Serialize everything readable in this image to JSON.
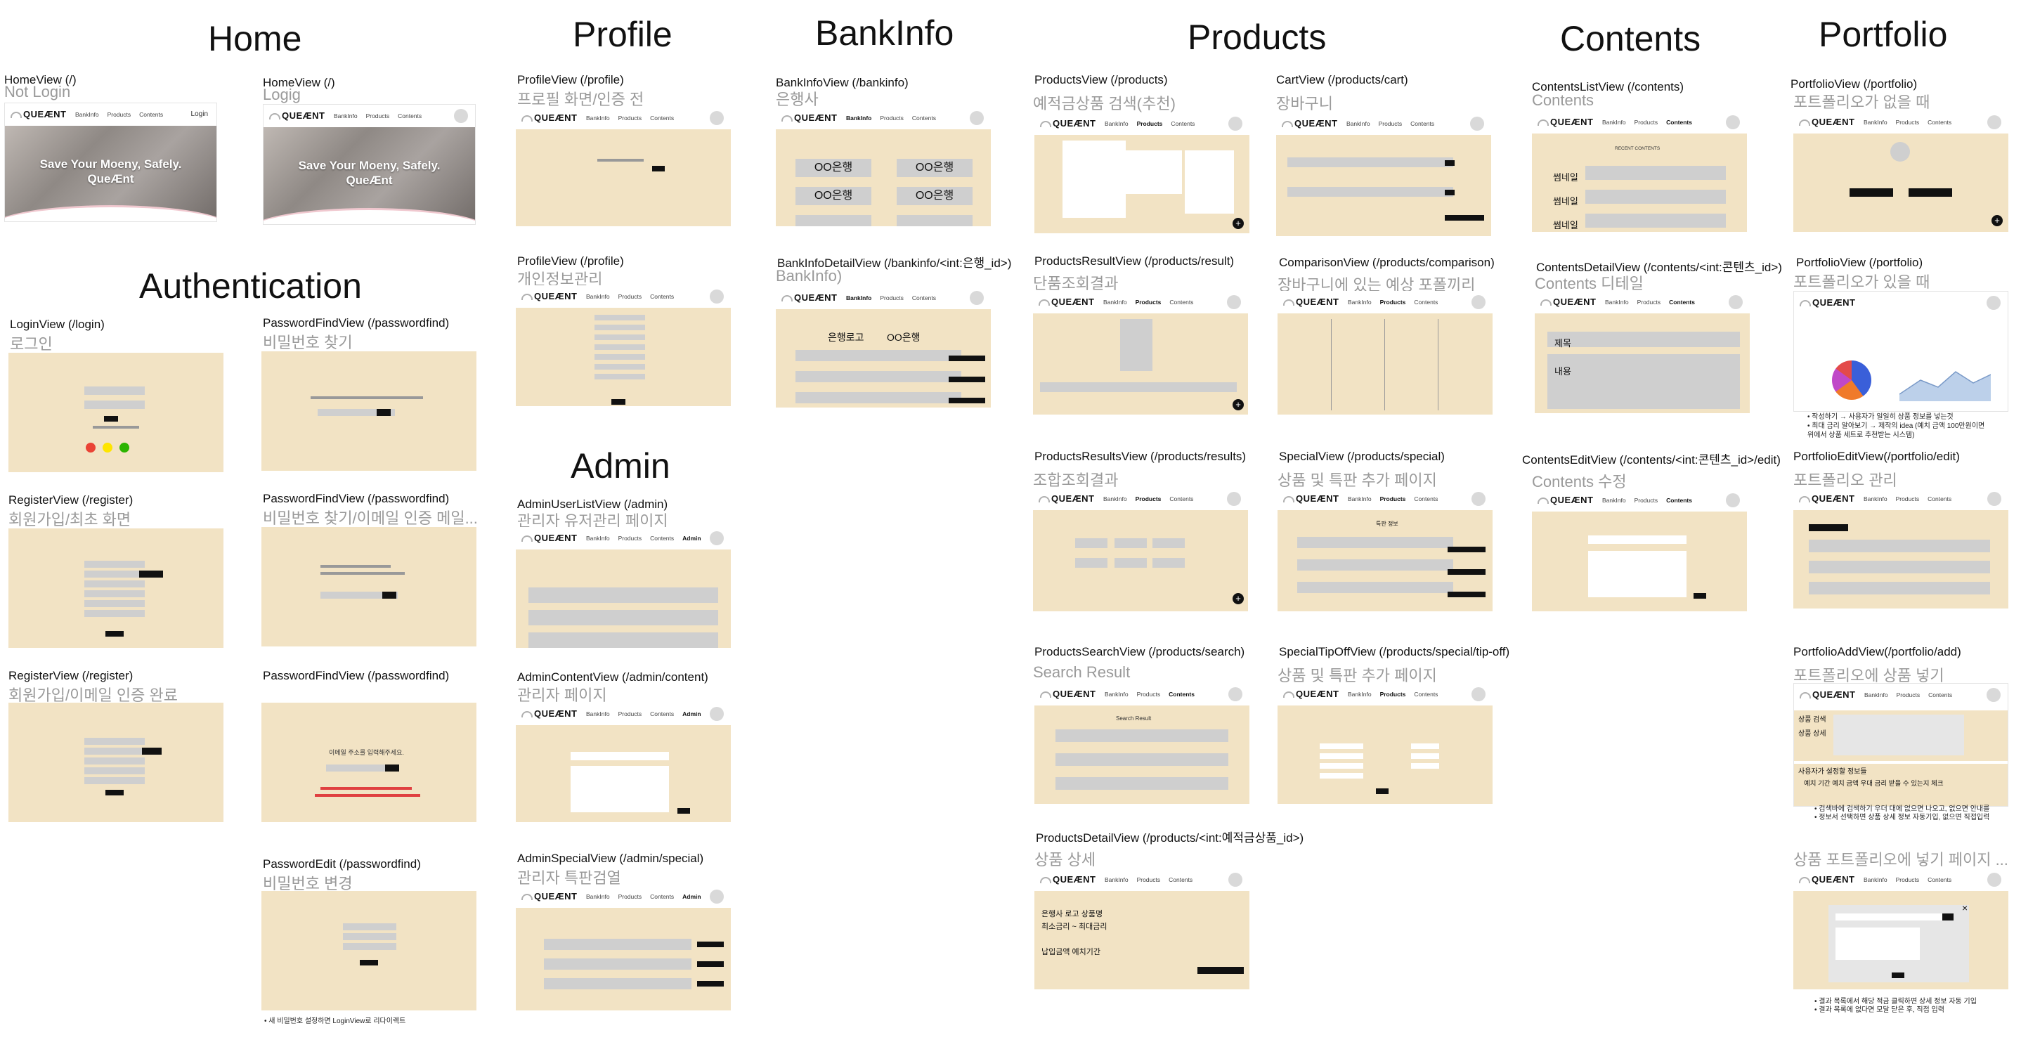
{
  "sections": {
    "home": "Home",
    "profile": "Profile",
    "bankinfo": "BankInfo",
    "products": "Products",
    "contents": "Contents",
    "portfolio": "Portfolio",
    "authentication": "Authentication",
    "admin": "Admin"
  },
  "app": {
    "logo": "QUEÆNT",
    "nav": [
      "BankInfo",
      "Products",
      "Contents"
    ],
    "nav_admin": "Admin",
    "login": "Login",
    "hero_line1": "Save Your Moeny, Safely.",
    "hero_line2": "QueÆnt"
  },
  "screens": {
    "home_nl": {
      "label": "HomeView (/)",
      "sub": "Not Login"
    },
    "home_l": {
      "label": "HomeView (/)",
      "sub": "Logig"
    },
    "login": {
      "label": "LoginView (/login)",
      "sub": "로그인"
    },
    "pwfind1": {
      "label": "PasswordFindView (/passwordfind)",
      "sub": "비밀번호 찾기"
    },
    "register1": {
      "label": "RegisterView (/register)",
      "sub": "회원가입/최초 화면"
    },
    "pwfind2": {
      "label": "PasswordFindView (/passwordfind)",
      "sub": "비밀번호 찾기/이메일 인증 메일..."
    },
    "register2": {
      "label": "RegisterView (/register)",
      "sub": "회원가입/이메일 인증 완료"
    },
    "pwfind3": {
      "label": "PasswordFindView (/passwordfind)",
      "sub": ""
    },
    "pwedit": {
      "label": "PasswordEdit (/passwordfind)",
      "sub": "비밀번호 변경"
    },
    "profile1": {
      "label": "ProfileView (/profile)",
      "sub": "프로필 화면/인증 전"
    },
    "profile2": {
      "label": "ProfileView (/profile)",
      "sub": "개인정보관리"
    },
    "admin_user": {
      "label": "AdminUserListView (/admin)",
      "sub": "관리자 유저관리 페이지"
    },
    "admin_content": {
      "label": "AdminContentView (/admin/content)",
      "sub": "관리자 페이지"
    },
    "admin_special": {
      "label": "AdminSpecialView (/admin/special)",
      "sub": "관리자 특판검열"
    },
    "bankinfo": {
      "label": "BankInfoView (/bankinfo)",
      "sub": "은행사"
    },
    "bankinfo_detail": {
      "label": "BankInfoDetailView (/bankinfo/<int:은행_id>)",
      "sub": "BankInfo)"
    },
    "products": {
      "label": "ProductsView (/products)",
      "sub": "예적금상품 검색(추천)"
    },
    "cart": {
      "label": "CartView (/products/cart)",
      "sub": "장바구니"
    },
    "products_result": {
      "label": "ProductsResultView (/products/result)",
      "sub": "단품조회결과"
    },
    "comparison": {
      "label": "ComparisonView (/products/comparison)",
      "sub": "장바구니에 있는 예상 포폴끼리"
    },
    "products_results": {
      "label": "ProductsResultsView (/products/results)",
      "sub": "조합조회결과"
    },
    "special": {
      "label": "SpecialView (/products/special)",
      "sub": "상품 및 특판 추가 페이지"
    },
    "products_search": {
      "label": "ProductsSearchView (/products/search)",
      "sub": "Search Result"
    },
    "special_tipoff": {
      "label": "SpecialTipOffView (/products/special/tip-off)",
      "sub": "상품 및 특판 추가 페이지"
    },
    "products_detail": {
      "label": "ProductsDetailView (/products/<int:예적금상품_id>)",
      "sub": "상품 상세"
    },
    "contents_list": {
      "label": "ContentsListView (/contents)",
      "sub": "Contents"
    },
    "contents_detail": {
      "label": "ContentsDetailView (/contents/<int:콘텐츠_id>)",
      "sub": "Contents 디테일"
    },
    "contents_edit": {
      "label": "ContentsEditView (/contents/<int:콘텐츠_id>/edit)",
      "sub": "Contents 수정"
    },
    "portfolio_empty": {
      "label": "PortfolioView (/portfolio)",
      "sub": "포트폴리오가 없을 때"
    },
    "portfolio_has": {
      "label": "PortfolioView (/portfolio)",
      "sub": "포트폴리오가 있을 때"
    },
    "portfolio_edit": {
      "label": "PortfolioEditView(/portfolio/edit)",
      "sub": "포트폴리오 관리"
    },
    "portfolio_add": {
      "label": "PortfolioAddView(/portfolio/add)",
      "sub": "포트폴리오에 상품 넣기"
    },
    "portfolio_add2": {
      "label": "",
      "sub": "상품 포트폴리오에 넣기 페이지 ..."
    }
  },
  "frame_text": {
    "bank_name": "OO은행",
    "bank_logo": "은행로고",
    "thumbnail": "썸네일",
    "title": "제목",
    "content": "내용",
    "recent_contents": "RECENT CONTENTS",
    "search_result": "Search Result",
    "special_info": "특판 정보",
    "detail_bank_logo": "은행사 로고   상품명",
    "detail_rate": "최소금리 ~ 최대금리",
    "detail_pay": "납입금액    예치기간",
    "pf_search": "상품 검색",
    "pf_detail": "상품 상세",
    "pf_settings": "사용자가 설정할 정보들",
    "pf_cols": "예치 기간        예치 금액        우대 금리 받을 수 있는지 체크",
    "email_sent": "이메일 주소를 입력해주세요."
  },
  "notes": {
    "pwedit": "• 새 비밀번호 설정하면 LoginView로 리다이렉트",
    "portfolio_has_1": "• 작성하기 → 사용자가 일일히 상품 정보를 넣는것",
    "portfolio_has_2": "• 최대 금리 알아보기 → 제작의 idea (예치 금액 100만원이면",
    "portfolio_has_3": "  위에서 상품 세트로 추천받는 시스템)",
    "portfolio_add_1": "• 검색바에 검색하기 우더 대에 없으면 나오고, 없으면 안내를",
    "portfolio_add_2": "• 정보서 선택하면 상품 상세 정보 자동기입, 없으면 직접입력",
    "portfolio_add2_1": "• 결과 목록에서 해당 적금 클릭하면 상세 정보 자동 기입",
    "portfolio_add2_2": "• 결과 목록에 없다면 모달 닫은 후, 직접 입력"
  }
}
